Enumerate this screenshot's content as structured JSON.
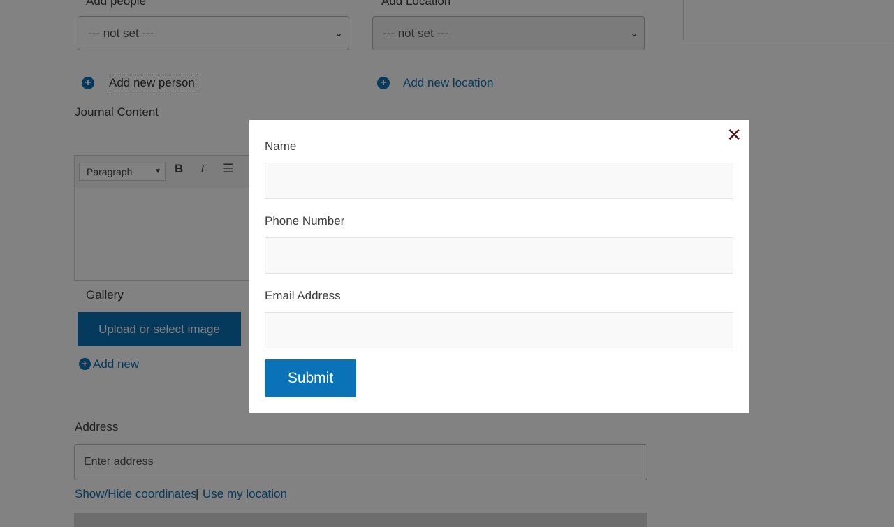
{
  "form": {
    "add_people_label": "Add people",
    "add_location_label": "Add Location",
    "people_select_value": "--- not set ---",
    "location_select_value": "--- not set ---",
    "add_person_link": "Add new person",
    "add_location_link": "Add new location",
    "journal_content_label": "Journal Content",
    "editor_format_value": "Paragraph",
    "gallery_label": "Gallery",
    "upload_button": "Upload or select image",
    "add_new_link": "Add new",
    "address_label": "Address",
    "address_placeholder": "Enter address",
    "show_hide_coordinates": "Show/Hide coordinates",
    "separator": "|",
    "use_my_location": "Use my location"
  },
  "modal": {
    "name_label": "Name",
    "phone_label": "Phone Number",
    "email_label": "Email Address",
    "submit_label": "Submit",
    "close_symbol": "✕"
  },
  "icons": {
    "plus": "+",
    "chevron": "⌄",
    "bold": "B",
    "italic": "I",
    "list": "☰"
  },
  "colors": {
    "accent": "#0a73b7",
    "overlay": "rgba(0,0,0,0.49)"
  }
}
